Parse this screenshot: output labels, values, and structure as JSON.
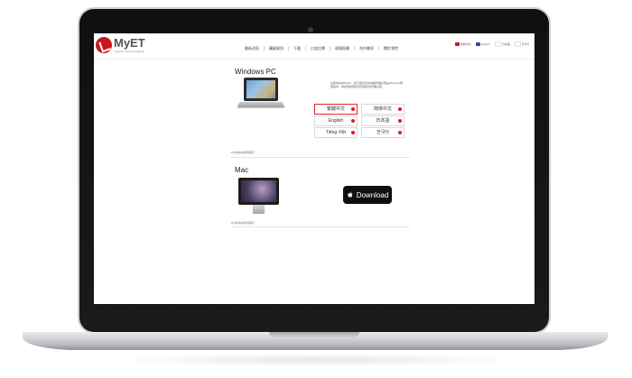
{
  "site": {
    "logo_text": "MyET",
    "logo_tagline": "English Communications",
    "nav": [
      "最新消息",
      "購買資訊",
      "下載",
      "口說比賽",
      "現場直播",
      "合作夥伴",
      "關於我們"
    ],
    "languages": [
      {
        "name": "繁體中文",
        "flag_color": "#c8161d"
      },
      {
        "name": "English",
        "flag_color": "#2c4d9a"
      },
      {
        "name": "日本語",
        "flag_color": "#ffffff"
      },
      {
        "name": "한국어",
        "flag_color": "#ffffff"
      }
    ]
  },
  "windows": {
    "title": "Windows PC",
    "description": "在各版本的MyET，如不確定您的電腦作業系統是Windows哪個版本，請參閱說明如何查看您的作業系統。",
    "buttons": [
      "繁體中文",
      "简体中文",
      "English",
      "日本語",
      "Tiếng Việt",
      "한국어"
    ],
    "note": "DIS版本為使用程序"
  },
  "mac": {
    "title": "Mac",
    "download_label": "Download",
    "note": "DIS版本為使用程序"
  }
}
